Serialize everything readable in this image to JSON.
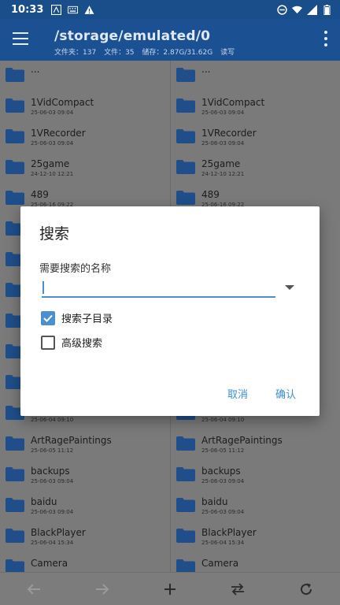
{
  "status_bar": {
    "time": "10:33",
    "left_icons": [
      "a-box-icon",
      "keyboard-icon",
      "warning-icon"
    ],
    "right_icons": [
      "dnd-icon",
      "wifi-icon",
      "signal-icon",
      "battery-icon"
    ]
  },
  "app_bar": {
    "path": "/storage/emulated/0",
    "stats": {
      "folders": "文件夹：137",
      "files": "文件：35",
      "storage": "储存：2.87G/31.62G",
      "mode": "读写"
    }
  },
  "left_pane": [
    {
      "name": "...",
      "date": ""
    },
    {
      "name": "1VidCompact",
      "date": "25-06-03 09:04"
    },
    {
      "name": "1VRecorder",
      "date": "25-06-03 09:04"
    },
    {
      "name": "25game",
      "date": "24-12-10 12:21"
    },
    {
      "name": "489",
      "date": "25-06-16 09:22"
    },
    {
      "name": "",
      "date": ""
    },
    {
      "name": "",
      "date": ""
    },
    {
      "name": "",
      "date": ""
    },
    {
      "name": "",
      "date": ""
    },
    {
      "name": "",
      "date": ""
    },
    {
      "name": "",
      "date": ""
    },
    {
      "name": "",
      "date": "25-06-04 09:10"
    },
    {
      "name": "ArtRagePaintings",
      "date": "25-06-05 11:12"
    },
    {
      "name": "backups",
      "date": "25-06-03 09:04"
    },
    {
      "name": "baidu",
      "date": "25-06-03 09:04"
    },
    {
      "name": "BlackPlayer",
      "date": "25-06-04 15:34"
    },
    {
      "name": "Camera",
      "date": ""
    }
  ],
  "right_pane": [
    {
      "name": "...",
      "date": ""
    },
    {
      "name": "1VidCompact",
      "date": "25-06-03 09:04"
    },
    {
      "name": "1VRecorder",
      "date": "25-06-03 09:04"
    },
    {
      "name": "25game",
      "date": "24-12-10 12:21"
    },
    {
      "name": "489",
      "date": "25-06-16 09:22"
    },
    {
      "name": "",
      "date": ""
    },
    {
      "name": "",
      "date": ""
    },
    {
      "name": "",
      "date": ""
    },
    {
      "name": "",
      "date": ""
    },
    {
      "name": "",
      "date": ""
    },
    {
      "name": "",
      "date": ""
    },
    {
      "name": "",
      "date": "25-06-04 09:10"
    },
    {
      "name": "ArtRagePaintings",
      "date": "25-06-05 11:12"
    },
    {
      "name": "backups",
      "date": "25-06-03 09:04"
    },
    {
      "name": "baidu",
      "date": "25-06-03 09:04"
    },
    {
      "name": "BlackPlayer",
      "date": "25-06-04 15:34"
    },
    {
      "name": "Camera",
      "date": ""
    }
  ],
  "dialog": {
    "title": "搜索",
    "label": "需要搜索的名称",
    "input_value": "",
    "checkboxes": [
      {
        "label": "搜索子目录",
        "checked": true
      },
      {
        "label": "高级搜索",
        "checked": false
      }
    ],
    "cancel": "取消",
    "confirm": "确认"
  },
  "toolbar": [
    "back-arrow-icon",
    "forward-arrow-icon",
    "add-icon",
    "swap-icon",
    "refresh-icon"
  ],
  "colors": {
    "app_bar": "#1b5193",
    "folder": "#1f4e8a",
    "accent": "#4a90d0"
  }
}
